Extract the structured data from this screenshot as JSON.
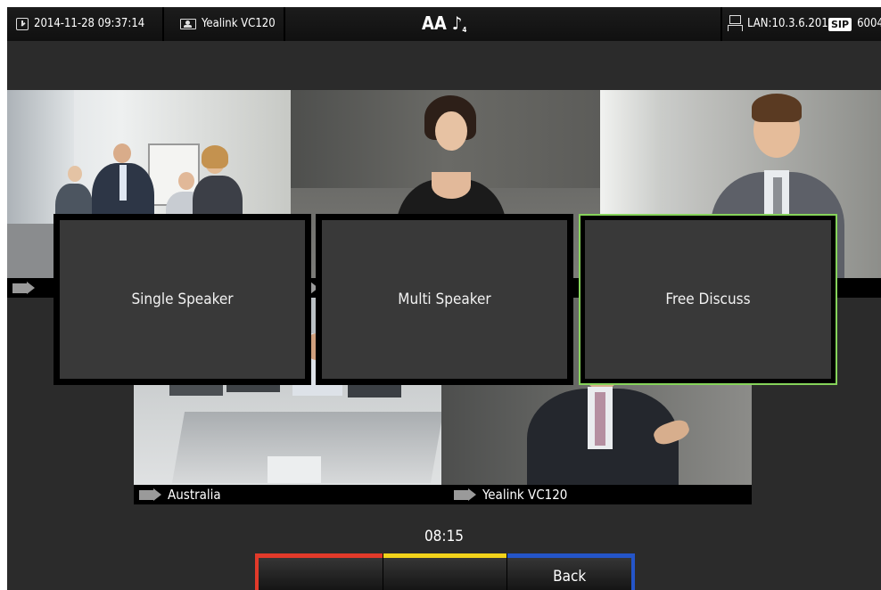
{
  "status_bar": {
    "datetime": "2014-11-28 09:37:14",
    "device_name": "Yealink VC120",
    "center_text_icon": "AA",
    "center_subscript": "4",
    "lan": "LAN:10.3.6.201",
    "sip_badge": "SIP",
    "sip_account": "6004"
  },
  "icons": {
    "datetime": "clock-icon",
    "device": "device-icon",
    "text_size": "text-size-icon",
    "phone": "phone-icon",
    "lan": "network-icon",
    "camera": "camera-icon"
  },
  "tiles": {
    "top_left_label": "",
    "top_middle_label": "",
    "top_right_label": "",
    "bottom_left_label": "Australia",
    "bottom_right_label": "Yealink VC120"
  },
  "modes": {
    "single": "Single Speaker",
    "multi": "Multi Speaker",
    "free": "Free Discuss",
    "selected": "Free Discuss"
  },
  "call_timer": "08:15",
  "softkeys": {
    "key1": "",
    "key2": "",
    "key3": "Back",
    "colors": [
      "#e23a2a",
      "#f2d21a",
      "#2455c8"
    ]
  },
  "colors": {
    "selection_border": "#86d35a",
    "background": "#2b2b2b"
  }
}
